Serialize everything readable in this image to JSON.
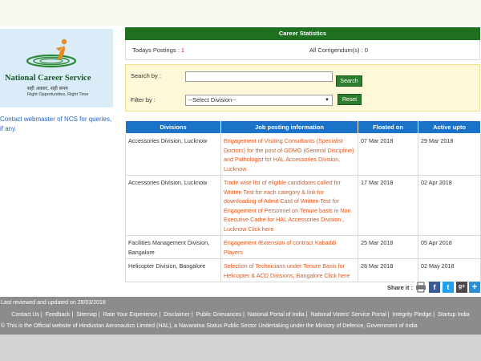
{
  "logo": {
    "title": "National Career Service",
    "hindi": "सही अवसर, सही समय",
    "tagline": "Right Opportunities, Right Time"
  },
  "contact_text": "Contact webmaster of NCS for queries, if any.",
  "career_stats": {
    "title": "Career Statistics",
    "postings_label": "Todays Postings",
    "postings_value": "1",
    "corrigendum_label": "All Corrigendum(s)",
    "corrigendum_value": "0"
  },
  "search": {
    "search_label": "Search by :",
    "search_value": "",
    "search_button": "Search",
    "filter_label": "Filter by :",
    "division_selected": "--Select Division--",
    "reset_button": "Reset"
  },
  "table": {
    "headers": [
      "Divisions",
      "Job posting information",
      "Floated on",
      "Active upto"
    ],
    "rows": [
      {
        "division": "Accessories Division, Lucknow",
        "info": "Engagement of Visiting Consultants (Specialist Doctors) for the post of GDMO (General Discipline) and Pathologist for HAL Accessories Division, Lucknow.",
        "floated": "07 Mar 2018",
        "active": "29 Mar 2018"
      },
      {
        "division": "Accessories Division, Lucknow",
        "info": "Trade wise list of eligible candidates called for Written Test for each category & link for downloading of Admit Card of Written Test for Engagement of Personnel on Tenure basis in Non Executive Cadre for HAL Accessories Division , Lucknow Click here",
        "floated": "17 Mar 2018",
        "active": "02 Apr 2018"
      },
      {
        "division": "Facilities Management Division, Bangalore",
        "info": "Engagement /Extension of contract Kabaddi Players",
        "floated": "25 Mar 2018",
        "active": "05 Apr 2018"
      },
      {
        "division": "Helicopter Division, Bangalore",
        "info": "Selection of Technicians under Tenure Basis for Helicopter & ACD Divisions, Bangalore Click here",
        "floated": "28 Mar 2018",
        "active": "02 May 2018"
      }
    ]
  },
  "share": {
    "label": "Share it :",
    "icons": [
      "print-icon",
      "facebook-icon",
      "twitter-icon",
      "google-plus-icon",
      "addthis-plus-icon"
    ]
  },
  "footer": {
    "reviewed": "Last reviewed and updated on 28/03/2018",
    "links": [
      "Contact Us",
      "Feedback",
      "Sitemap",
      "Rate Your Experience",
      "Disclaimer",
      "Public Grievances",
      "National Portal of India",
      "National Voters' Service Portal",
      "Integrity Pledge",
      "Startup India"
    ],
    "copyright": "© This is the Official website of Hindustan Aeronautics Limited (HAL), a Navaratna Status Public Sector Undertaking under the Ministry of Defence, Government of India"
  },
  "colors": {
    "stats_header": "#1e6f1e",
    "table_header": "#1a73c9",
    "link_orange": "#e0571e",
    "footer_bg": "#8c8c8c"
  }
}
